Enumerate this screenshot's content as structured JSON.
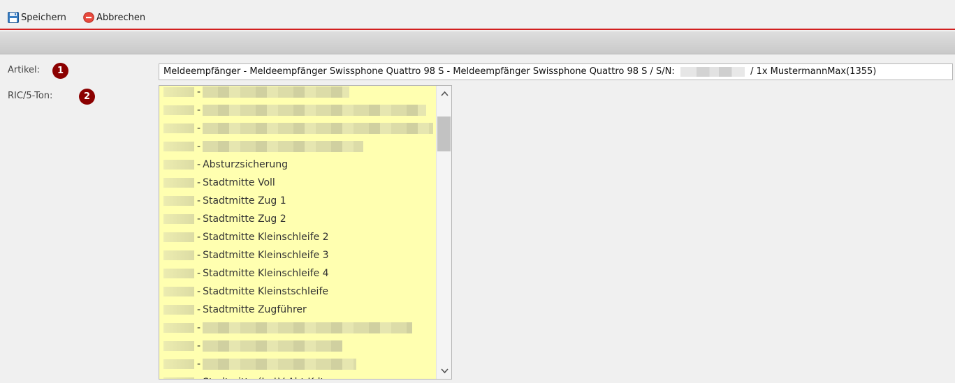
{
  "toolbar": {
    "save_label": "Speichern",
    "cancel_label": "Abbrechen"
  },
  "form": {
    "artikel_label": "Artikel:",
    "artikel_badge": "1",
    "artikel_value_prefix": "Meldeempfänger - Meldeempfänger Swissphone Quattro 98 S - Meldeempfänger Swissphone Quattro 98 S / S/N:",
    "artikel_value_suffix": "/ 1x MustermannMax(1355)",
    "ric_label": "RIC/5-Ton:",
    "ric_badge": "2"
  },
  "ric_list": {
    "items": [
      {
        "text": "",
        "redacted": true
      },
      {
        "text": "",
        "redacted": true
      },
      {
        "text": "",
        "redacted": true
      },
      {
        "text": "",
        "redacted": true
      },
      {
        "text": "Absturzsicherung",
        "redacted": false
      },
      {
        "text": "Stadtmitte Voll",
        "redacted": false
      },
      {
        "text": "Stadtmitte Zug 1",
        "redacted": false
      },
      {
        "text": "Stadtmitte Zug 2",
        "redacted": false
      },
      {
        "text": "Stadtmitte Kleinschleife 2",
        "redacted": false
      },
      {
        "text": "Stadtmitte Kleinschleife 3",
        "redacted": false
      },
      {
        "text": "Stadtmitte Kleinschleife 4",
        "redacted": false
      },
      {
        "text": "Stadtmitte Kleinstschleife",
        "redacted": false
      },
      {
        "text": "Stadtmitte Zugführer",
        "redacted": false
      },
      {
        "text": "",
        "redacted": true
      },
      {
        "text": "",
        "redacted": true
      },
      {
        "text": "",
        "redacted": true
      },
      {
        "text": "Stadtmitte (L.-LV Abt.Kdt",
        "redacted": false
      }
    ]
  },
  "colors": {
    "accent_line": "#d21f1f",
    "badge": "#8b0000",
    "list_background": "#ffffb0"
  },
  "icons": {
    "save": "floppy-disk-icon",
    "cancel": "red-circle-minus-icon",
    "scroll_up": "chevron-up-icon",
    "scroll_down": "chevron-down-icon"
  }
}
